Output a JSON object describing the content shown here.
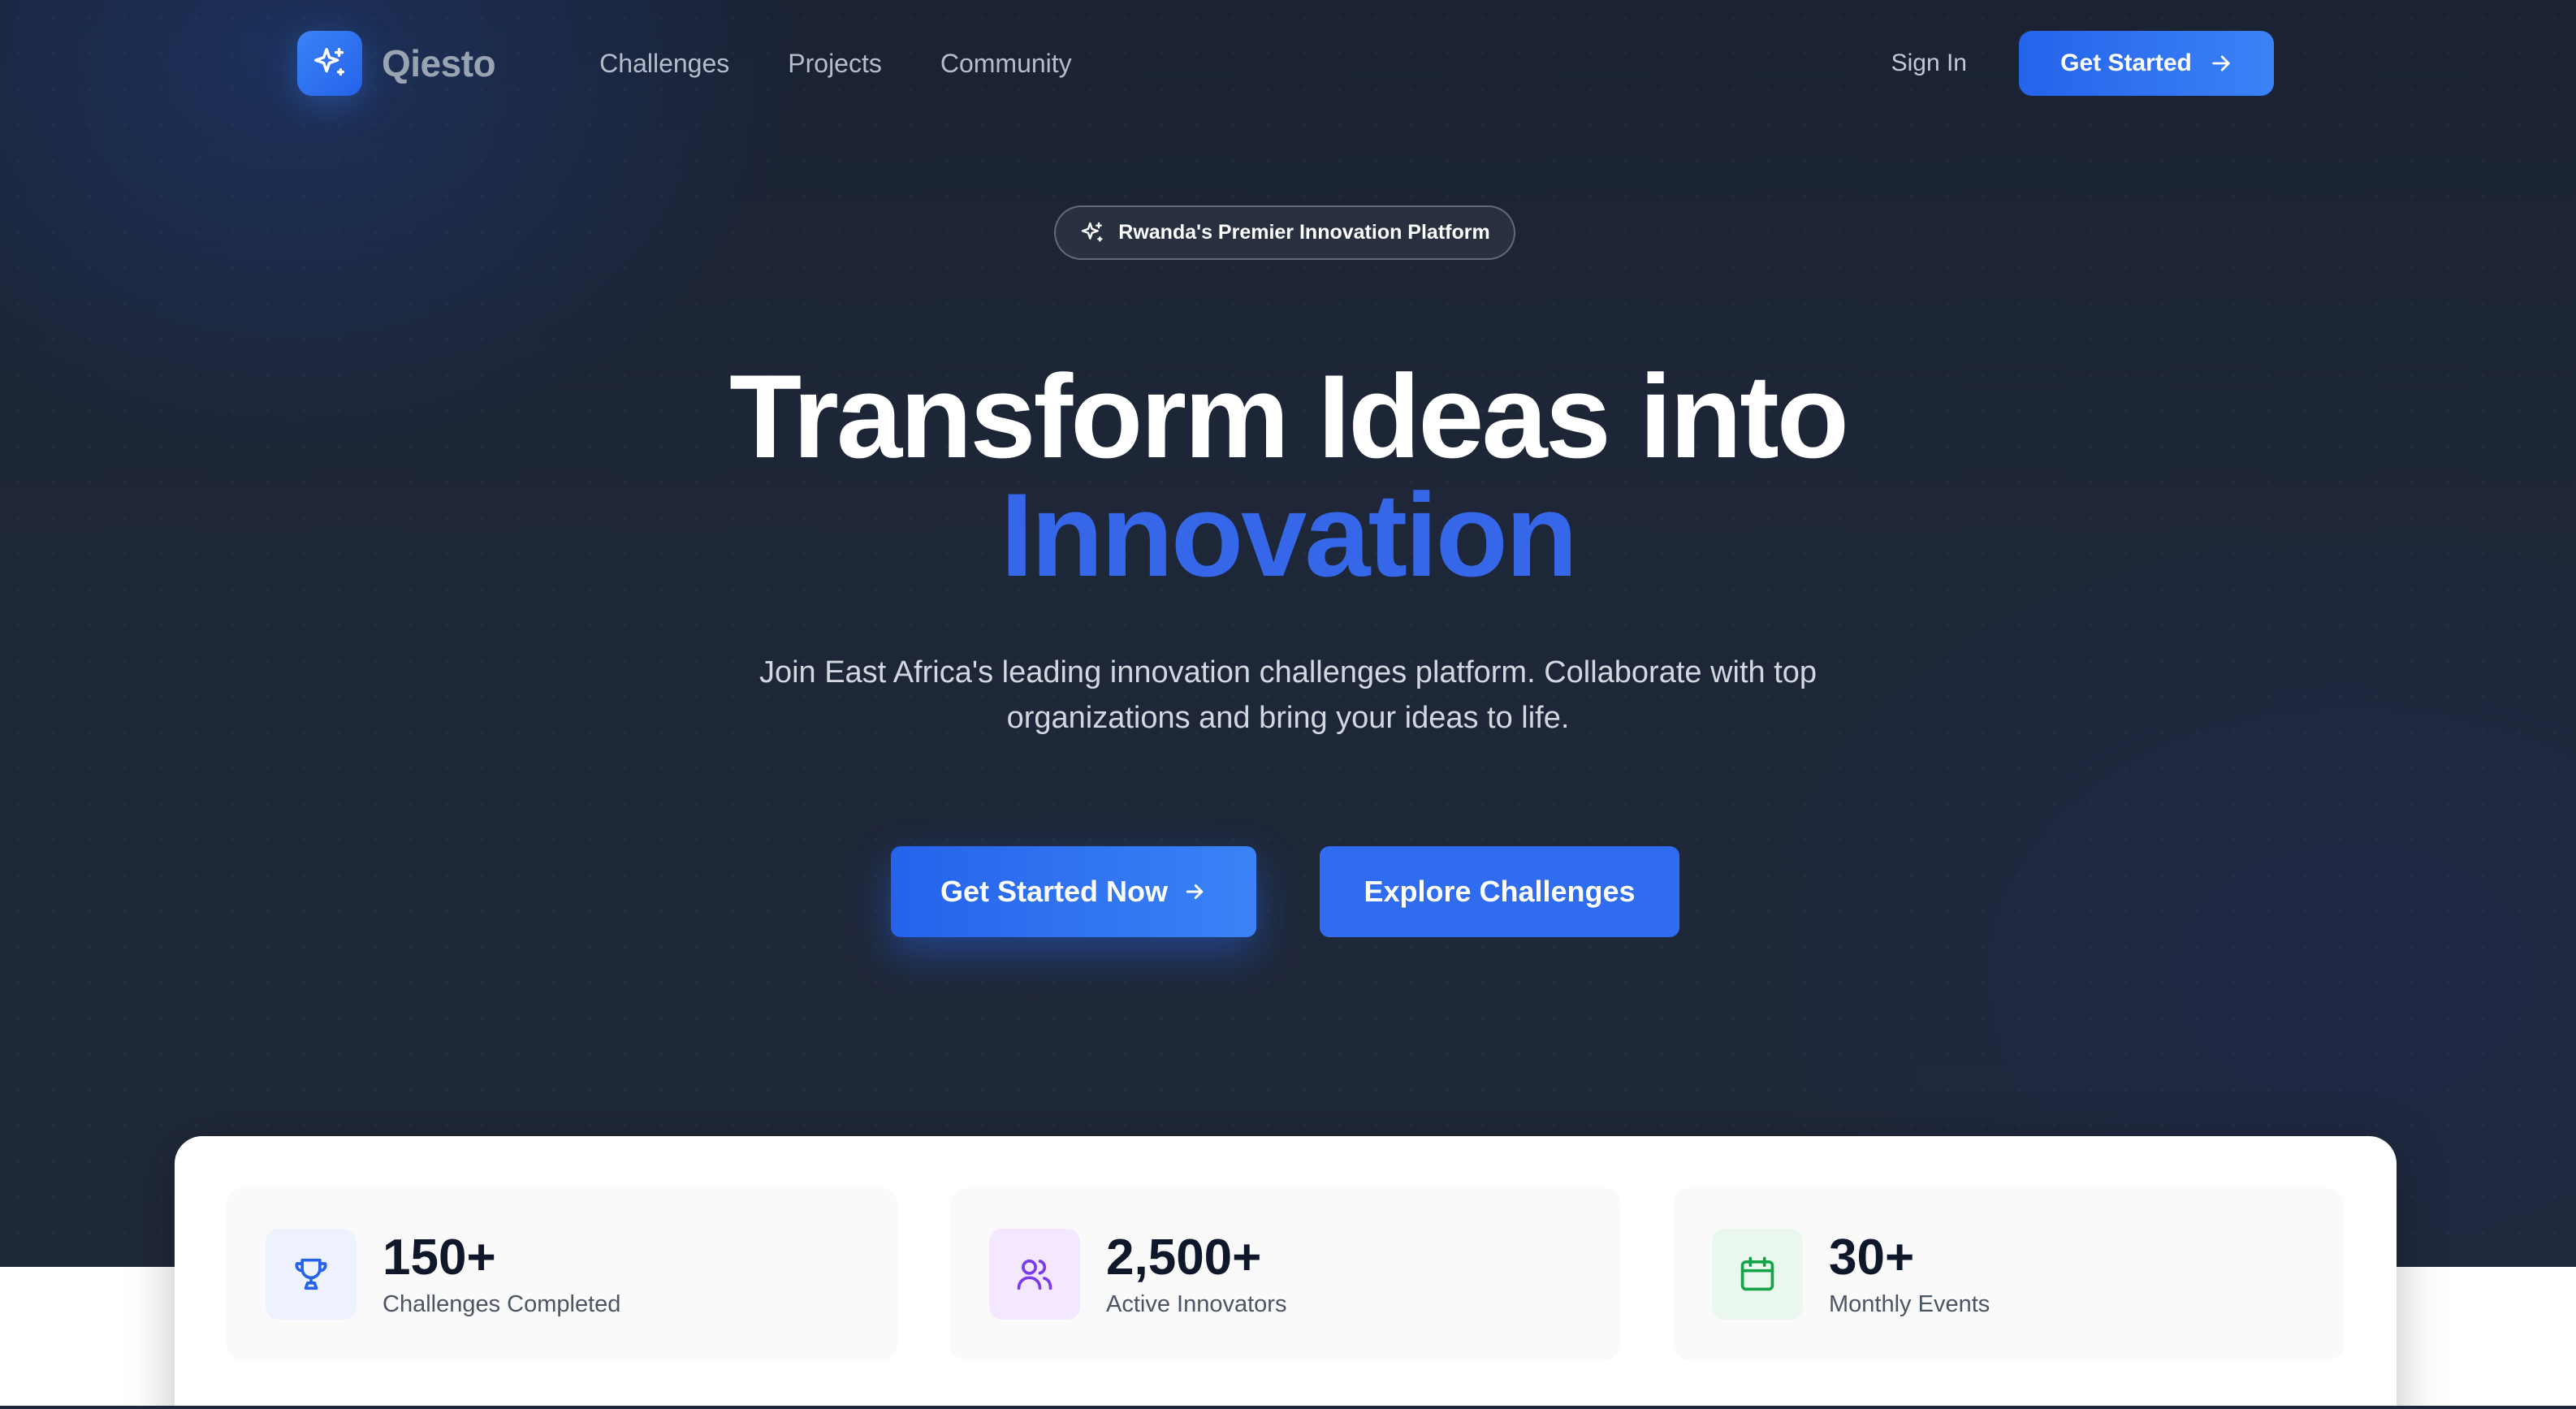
{
  "nav": {
    "brand": "Qiesto",
    "links": [
      "Challenges",
      "Projects",
      "Community"
    ],
    "sign_in": "Sign In",
    "get_started": "Get Started"
  },
  "hero": {
    "badge": "Rwanda's Premier Innovation Platform",
    "title_line1": "Transform Ideas into",
    "title_line2": "Innovation",
    "subtitle": "Join East Africa's leading innovation challenges platform. Collaborate with top organizations and bring your ideas to life.",
    "cta_primary": "Get Started Now",
    "cta_secondary": "Explore Challenges"
  },
  "stats": [
    {
      "value": "150+",
      "label": "Challenges Completed",
      "icon": "trophy-icon",
      "color": "#2563eb",
      "bg": "#eef2ff"
    },
    {
      "value": "2,500+",
      "label": "Active Innovators",
      "icon": "users-icon",
      "color": "#7c3aed",
      "bg": "#f3e8ff"
    },
    {
      "value": "30+",
      "label": "Monthly Events",
      "icon": "calendar-icon",
      "color": "#16a34a",
      "bg": "#e9f7ee"
    }
  ],
  "colors": {
    "accent": "#2563eb",
    "hero_bg": "#1e2738",
    "headline_accent": "#3567e8"
  }
}
